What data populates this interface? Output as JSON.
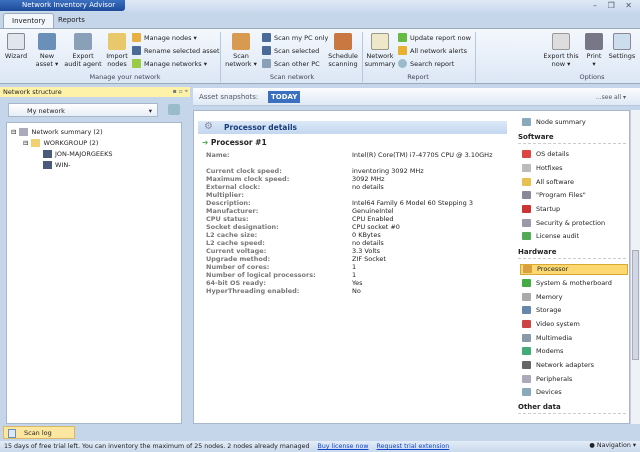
{
  "app": {
    "title": "Network Inventory Advisor",
    "window_controls": "– ❐ ✕"
  },
  "tabs": [
    {
      "label": "Inventory",
      "active": true
    },
    {
      "label": "Reports",
      "active": false
    }
  ],
  "ribbon": {
    "manage": {
      "wizard": "Wizard",
      "new_asset": "New asset ▾",
      "export_agent": "Export audit agent",
      "import_nodes": "Import nodes",
      "manage_nodes": "Manage nodes ▾",
      "rename": "Rename selected asset",
      "manage_networks": "Manage networks ▾",
      "group": "Manage your network"
    },
    "scan": {
      "scan_network": "Scan network ▾",
      "scan_my_pc": "Scan my PC only",
      "scan_selected": "Scan selected",
      "scan_other": "Scan other PC",
      "schedule": "Schedule scanning",
      "group": "Scan network"
    },
    "report": {
      "network_summary": "Network summary",
      "update": "Update report now",
      "alerts": "All network alerts",
      "search": "Search report",
      "group": "Report"
    },
    "options": {
      "export": "Export this now ▾",
      "print": "Print ▾",
      "settings": "Settings",
      "group": "Options"
    }
  },
  "left_panel": {
    "title": "Network structure",
    "tools": "▪ ▫ ⌖",
    "network_select": "My network",
    "tree": [
      "Network summary (2)",
      "WORKGROUP (2)",
      "JON-MAJORGEEKS",
      "WIN-"
    ]
  },
  "snapshots": {
    "label": "Asset snapshots:",
    "today": "TODAY",
    "see_all": "...see all ▾"
  },
  "details": {
    "title": "Processor details",
    "processor": "Processor #1",
    "rows": [
      {
        "k": "Name:",
        "v": "Intel(R) Core(TM) i7-4770S CPU @ 3.10GHz"
      },
      {
        "k": "Current clock speed:",
        "v": "inventoring 3092 MHz"
      },
      {
        "k": "Maximum clock speed:",
        "v": "3092 MHz"
      },
      {
        "k": "External clock:",
        "v": "no details"
      },
      {
        "k": "Multiplier:",
        "v": ""
      },
      {
        "k": "Description:",
        "v": "Intel64 Family 6 Model 60 Stepping 3"
      },
      {
        "k": "Manufacturer:",
        "v": "GenuineIntel"
      },
      {
        "k": "CPU status:",
        "v": "CPU Enabled"
      },
      {
        "k": "Socket designation:",
        "v": "CPU socket #0"
      },
      {
        "k": "L2 cache size:",
        "v": "0 KBytes"
      },
      {
        "k": "L2 cache speed:",
        "v": "no details"
      },
      {
        "k": "Current voltage:",
        "v": "3.3 Volts"
      },
      {
        "k": "Upgrade method:",
        "v": "ZIF Socket"
      },
      {
        "k": "Number of cores:",
        "v": "1"
      },
      {
        "k": "Number of logical processors:",
        "v": "1"
      },
      {
        "k": "64-bit OS ready:",
        "v": "Yes"
      },
      {
        "k": "HyperThreading enabled:",
        "v": "No"
      }
    ]
  },
  "right_panel": {
    "node_summary": "Node summary",
    "software_heading": "Software",
    "software": [
      "OS details",
      "Hotfixes",
      "All software",
      "\"Program Files\"",
      "Startup",
      "Security & protection",
      "License audit"
    ],
    "hardware_heading": "Hardware",
    "hardware": [
      "Processor",
      "System & motherboard",
      "Memory",
      "Storage",
      "Video system",
      "Multimedia",
      "Modems",
      "Network adapters",
      "Peripherals",
      "Devices"
    ],
    "other_heading": "Other data",
    "selected": "Processor"
  },
  "bottom": {
    "scan_log": "Scan log",
    "status": "15 days of free trial left. You can inventory the maximum of 25 nodes. 2 nodes already managed",
    "buy": "Buy license now",
    "trial": "Request trial extension",
    "navigation": "● Navigation ▾"
  }
}
